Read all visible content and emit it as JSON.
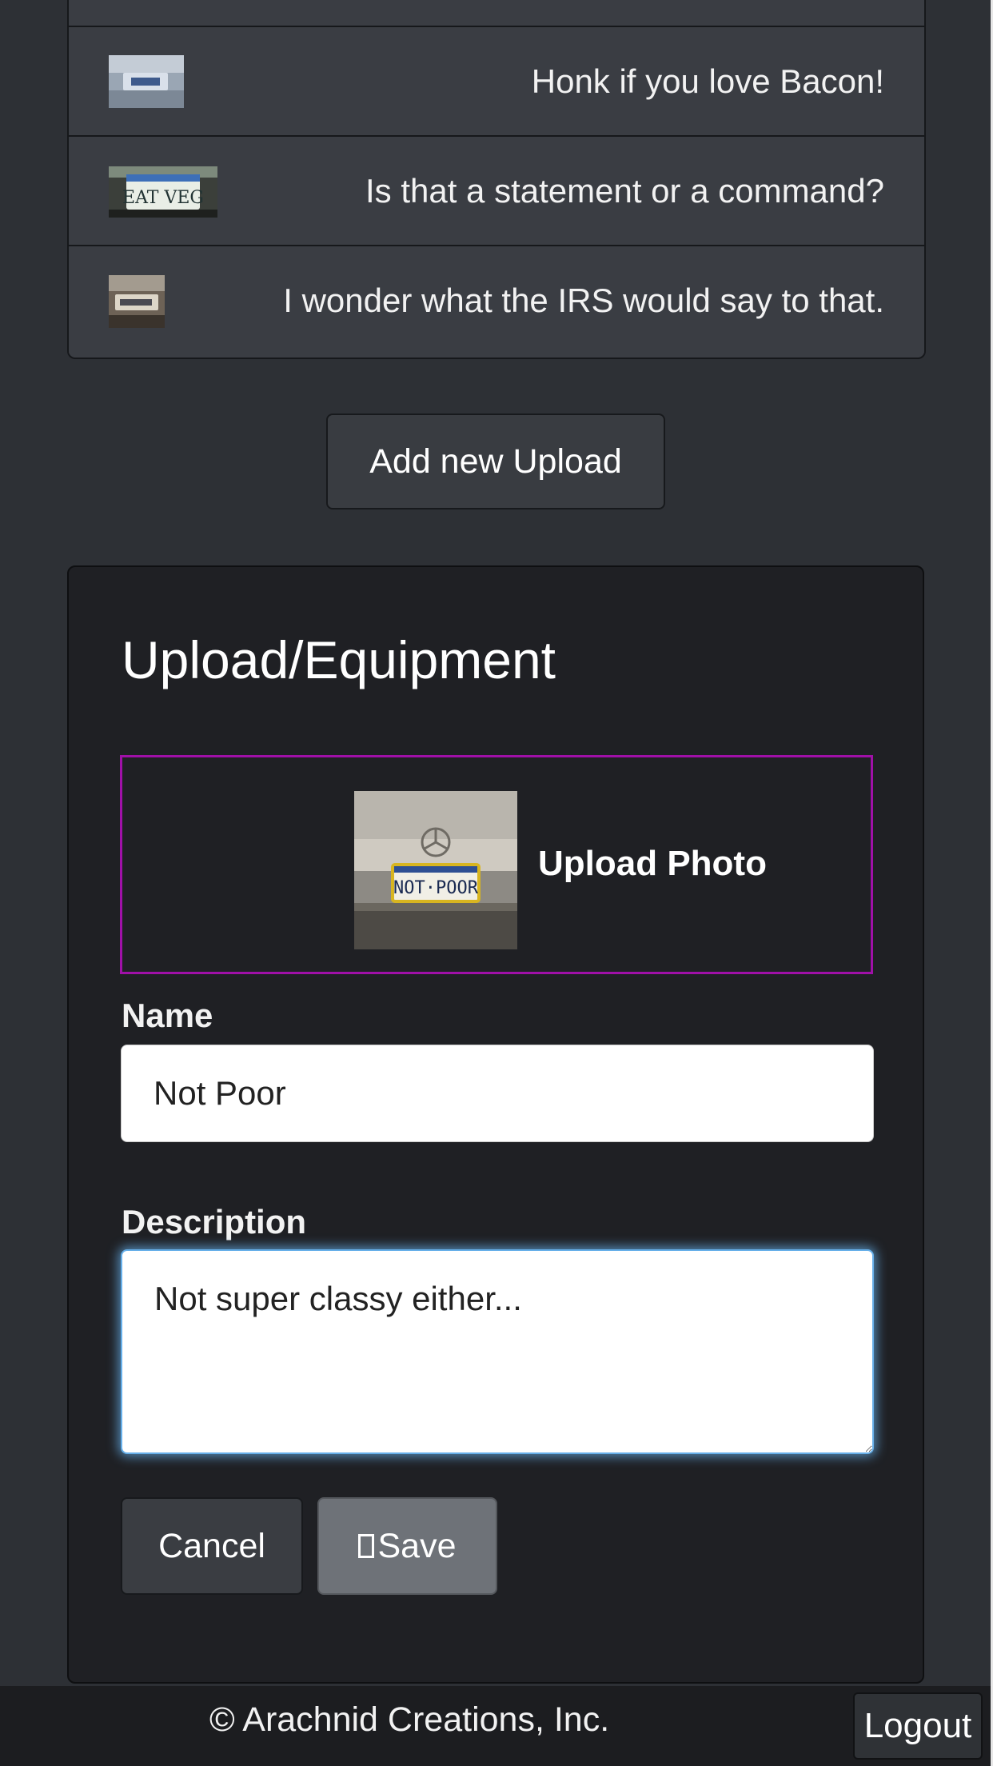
{
  "uploads": {
    "items": [
      {
        "caption": "Honk if you love Bacon!",
        "thumb": "license-plate-photo-thumbnail"
      },
      {
        "caption": "Is that a statement or a command?",
        "thumb": "eat-veg-plate-photo-thumbnail"
      },
      {
        "caption": "I wonder what the IRS would say to that.",
        "thumb": "license-plate-photo-thumbnail"
      }
    ],
    "add_button_label": "Add new Upload"
  },
  "form": {
    "title": "Upload/Equipment",
    "upload_photo_label": "Upload Photo",
    "name_label": "Name",
    "name_value": "Not Poor",
    "description_label": "Description",
    "description_value": "Not super classy either...",
    "cancel_label": "Cancel",
    "save_label": "Save",
    "save_icon": "floppy-disk-icon",
    "photo_frame_color": "#a010a8",
    "focus_color": "#66afe9"
  },
  "footer": {
    "copyright": "© Arachnid Creations, Inc.",
    "logout_label": "Logout"
  }
}
